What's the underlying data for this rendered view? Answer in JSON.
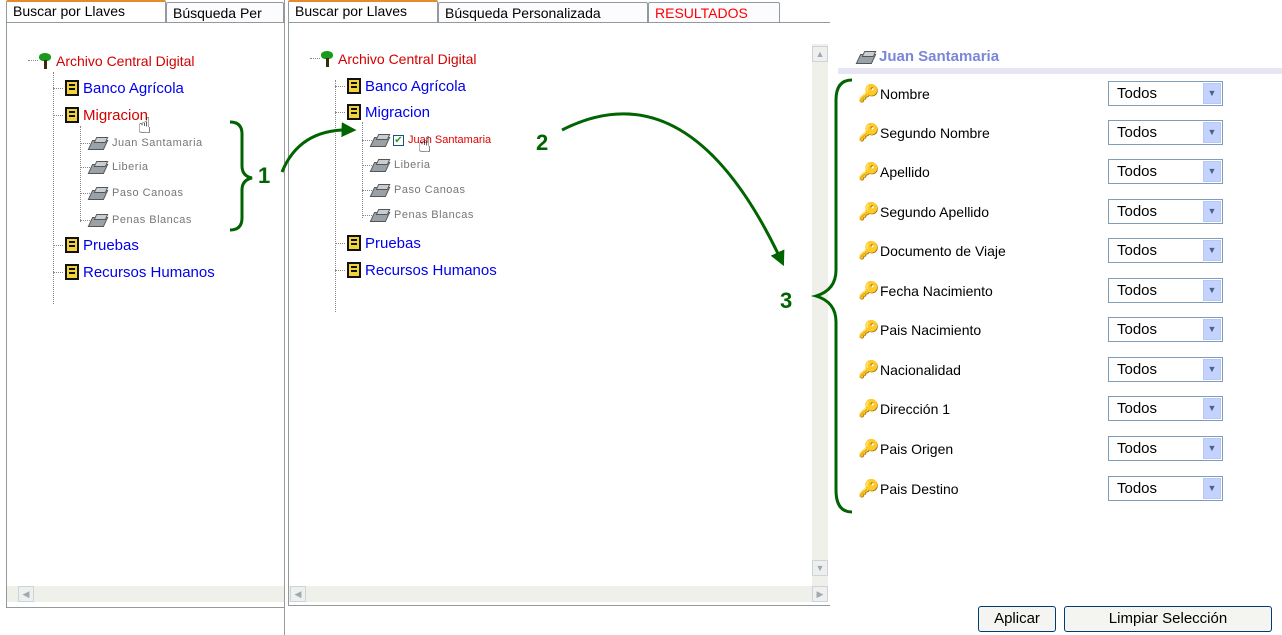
{
  "left_window": {
    "tabs": [
      {
        "label": "Buscar por Llaves"
      },
      {
        "label": "Búsqueda Per"
      }
    ],
    "tree": {
      "root": "Archivo Central Digital",
      "items": [
        {
          "label": "Banco Agrícola"
        },
        {
          "label": "Migracion"
        },
        {
          "label": "Juan Santamaria"
        },
        {
          "label": "Liberia"
        },
        {
          "label": "Paso Canoas"
        },
        {
          "label": "Penas Blancas"
        },
        {
          "label": "Pruebas"
        },
        {
          "label": "Recursos Humanos"
        }
      ]
    }
  },
  "main_window": {
    "tabs": [
      {
        "label": "Buscar por Llaves"
      },
      {
        "label": "Búsqueda Personalizada"
      },
      {
        "label": "RESULTADOS"
      }
    ],
    "tree": {
      "root": "Archivo Central Digital",
      "items": [
        {
          "label": "Banco Agrícola"
        },
        {
          "label": "Migracion"
        },
        {
          "label": "Juan Santamaria"
        },
        {
          "label": "Liberia"
        },
        {
          "label": "Paso Canoas"
        },
        {
          "label": "Penas Blancas"
        },
        {
          "label": "Pruebas"
        },
        {
          "label": "Recursos Humanos"
        }
      ]
    },
    "filters": {
      "heading": "Juan Santamaria",
      "rows": [
        {
          "label": "Nombre",
          "value": "Todos"
        },
        {
          "label": "Segundo Nombre",
          "value": "Todos"
        },
        {
          "label": "Apellido",
          "value": "Todos"
        },
        {
          "label": "Segundo Apellido",
          "value": "Todos"
        },
        {
          "label": "Documento de Viaje",
          "value": "Todos"
        },
        {
          "label": "Fecha Nacimiento",
          "value": "Todos"
        },
        {
          "label": "Pais Nacimiento",
          "value": "Todos"
        },
        {
          "label": "Nacionalidad",
          "value": "Todos"
        },
        {
          "label": "Dirección 1",
          "value": "Todos"
        },
        {
          "label": "Pais Origen",
          "value": "Todos"
        },
        {
          "label": "Pais Destino",
          "value": "Todos"
        }
      ]
    },
    "buttons": {
      "apply": "Aplicar",
      "clear": "Limpiar Selección"
    }
  },
  "annotations": {
    "one": "1",
    "two": "2",
    "three": "3",
    "color": "#006400"
  }
}
